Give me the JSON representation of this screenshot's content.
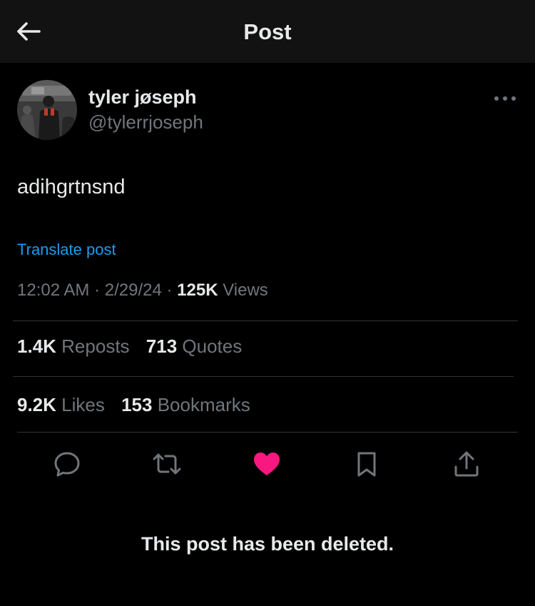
{
  "header": {
    "title": "Post",
    "back_icon": "arrow-left-icon"
  },
  "author": {
    "display_name": "tyler jøseph",
    "handle": "@tylerrjoseph",
    "more_icon": "more-horizontal-icon"
  },
  "post": {
    "text": "adihgrtnsnd",
    "translate_label": "Translate post",
    "time": "12:02 AM",
    "date": "2/29/24",
    "separator": "·",
    "views_count": "125K",
    "views_label": "Views"
  },
  "stats": {
    "reposts_count": "1.4K",
    "reposts_label": "Reposts",
    "quotes_count": "713",
    "quotes_label": "Quotes",
    "likes_count": "9.2K",
    "likes_label": "Likes",
    "bookmarks_count": "153",
    "bookmarks_label": "Bookmarks"
  },
  "actions": [
    {
      "name": "reply",
      "icon": "reply-bubble-icon"
    },
    {
      "name": "repost",
      "icon": "repost-arrows-icon"
    },
    {
      "name": "like",
      "icon": "heart-filled-icon",
      "active": true
    },
    {
      "name": "bookmark",
      "icon": "bookmark-icon"
    },
    {
      "name": "share",
      "icon": "share-upload-icon"
    }
  ],
  "status_message": "This post has been deleted.",
  "colors": {
    "background": "#000000",
    "header_background": "#121212",
    "text_primary": "#e7e9ea",
    "text_secondary": "#71767b",
    "link": "#1d9bf0",
    "like_active": "#f91880",
    "divider": "#2f3336"
  }
}
